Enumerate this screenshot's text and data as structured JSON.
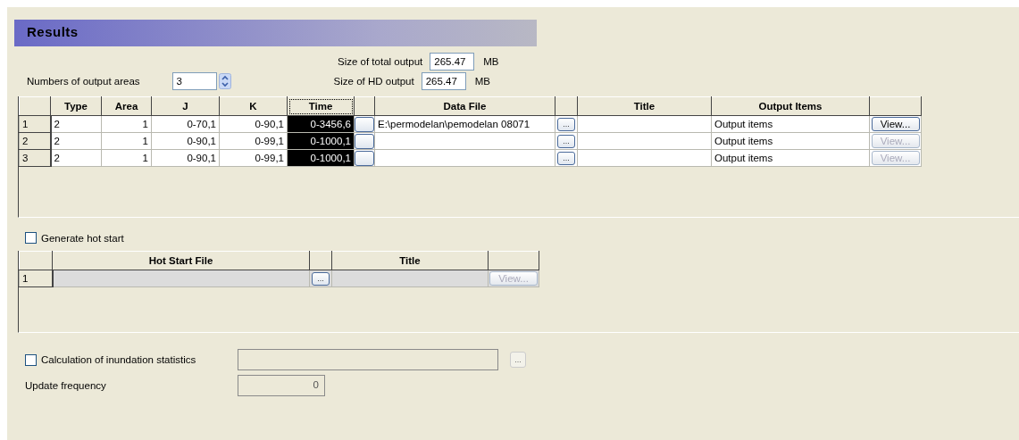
{
  "header": {
    "title": "Results"
  },
  "total_output": {
    "label": "Size of total output",
    "value": "265.47",
    "unit": "MB"
  },
  "output_areas": {
    "label": "Numbers of output areas",
    "value": "3"
  },
  "hd_output": {
    "label": "Size of HD output",
    "value": "265.47",
    "unit": "MB"
  },
  "table": {
    "columns": [
      {
        "label": "Type",
        "selected": false
      },
      {
        "label": "Area",
        "selected": false
      },
      {
        "label": "J",
        "selected": false
      },
      {
        "label": "K",
        "selected": false
      },
      {
        "label": "Time",
        "selected": true
      },
      {
        "label": "Data File",
        "selected": false
      },
      {
        "label": "Title",
        "selected": false
      },
      {
        "label": "Output Items",
        "selected": false
      }
    ],
    "rows": [
      {
        "index": "1",
        "type": "2",
        "area": "1",
        "j": "0-70,1",
        "k": "0-90,1",
        "time": "0-3456,6",
        "data_file": "E:\\permodelan\\pemodelan 08071",
        "browse": "...",
        "output_items": "Output items",
        "view": {
          "label": "View...",
          "disabled": false
        }
      },
      {
        "index": "2",
        "type": "2",
        "area": "1",
        "j": "0-90,1",
        "k": "0-99,1",
        "time": "0-1000,1",
        "browse": "...",
        "output_items": "Output items",
        "view": {
          "label": "View...",
          "disabled": true
        }
      },
      {
        "index": "3",
        "type": "2",
        "area": "1",
        "j": "0-90,1",
        "k": "0-99,1",
        "time": "0-1000,1",
        "browse": "...",
        "output_items": "Output items",
        "view": {
          "label": "View...",
          "disabled": true
        }
      }
    ]
  },
  "hot_start": {
    "label": "Generate hot start",
    "checked": false
  },
  "hot_table": {
    "columns": [
      "Hot Start File",
      "Title"
    ],
    "rows": [
      {
        "index": "1",
        "browse": "...",
        "view": {
          "label": "View...",
          "disabled": true
        }
      }
    ]
  },
  "inundation": {
    "label": "Calculation of inundation statistics",
    "checked": false,
    "browse": {
      "label": "...",
      "disabled": true
    }
  },
  "update_frequency": {
    "label": "Update frequency",
    "value": "0",
    "disabled": true
  }
}
